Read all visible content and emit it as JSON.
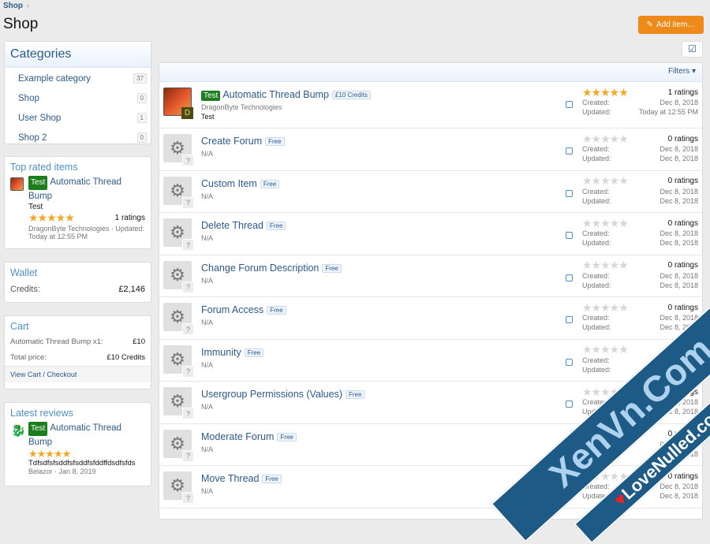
{
  "breadcrumb": "Shop",
  "title": "Shop",
  "add_item": "Add item…",
  "filters": "Filters",
  "categories": {
    "title": "Categories",
    "items": [
      {
        "label": "Example category",
        "count": "37"
      },
      {
        "label": "Shop",
        "count": "0"
      },
      {
        "label": "User Shop",
        "count": "1"
      },
      {
        "label": "Shop 2",
        "count": "0"
      }
    ]
  },
  "top_rated": {
    "title": "Top rated items",
    "tag": "Test",
    "name": "Automatic Thread Bump",
    "desc": "Test",
    "ratings": "1 ratings",
    "meta": "DragonByte Technologies · Updated: Today at 12:55 PM"
  },
  "wallet": {
    "title": "Wallet",
    "label": "Credits:",
    "value": "£2,146"
  },
  "cart": {
    "title": "Cart",
    "item": "Automatic Thread Bump x1:",
    "item_price": "£10",
    "total_label": "Total price:",
    "total": "£10 Credits",
    "checkout": "View Cart / Checkout"
  },
  "reviews": {
    "title": "Latest reviews",
    "tag": "Test",
    "name": "Automatic Thread Bump",
    "text": "Tdfsdfsfsddfsfsddfsfddffdsdfsfds",
    "meta": "Belazor · Jan 8, 2019"
  },
  "labels": {
    "created": "Created:",
    "updated": "Updated:"
  },
  "items": [
    {
      "tag": "Test",
      "name": "Automatic Thread Bump",
      "price": "£10 Credits",
      "author": "DragonByte Technologies",
      "desc": "Test",
      "rating": 5,
      "ratings": "1 ratings",
      "created": "Dec 8, 2018",
      "updated": "Today at 12:55 PM"
    },
    {
      "name": "Create Forum",
      "price": "Free",
      "author": "N/A",
      "rating": 0,
      "ratings": "0 ratings",
      "created": "Dec 8, 2018",
      "updated": "Dec 8, 2018"
    },
    {
      "name": "Custom Item",
      "price": "Free",
      "author": "N/A",
      "rating": 0,
      "ratings": "0 ratings",
      "created": "Dec 8, 2018",
      "updated": "Dec 8, 2018"
    },
    {
      "name": "Delete Thread",
      "price": "Free",
      "author": "N/A",
      "rating": 0,
      "ratings": "0 ratings",
      "created": "Dec 8, 2018",
      "updated": "Dec 8, 2018"
    },
    {
      "name": "Change Forum Description",
      "price": "Free",
      "author": "N/A",
      "rating": 0,
      "ratings": "0 ratings",
      "created": "Dec 8, 2018",
      "updated": "Dec 8, 2018"
    },
    {
      "name": "Forum Access",
      "price": "Free",
      "author": "N/A",
      "rating": 0,
      "ratings": "0 ratings",
      "created": "Dec 8, 2018",
      "updated": "Dec 8, 2018"
    },
    {
      "name": "Immunity",
      "price": "Free",
      "author": "N/A",
      "rating": 0,
      "ratings": "0 ratings",
      "created": "Dec 8, 2018",
      "updated": "Dec 8, 2018"
    },
    {
      "name": "Usergroup Permissions (Values)",
      "price": "Free",
      "author": "N/A",
      "rating": 0,
      "ratings": "0 ratings",
      "created": "Dec 8, 2018",
      "updated": "Dec 8, 2018"
    },
    {
      "name": "Moderate Forum",
      "price": "Free",
      "author": "N/A",
      "rating": 0,
      "ratings": "0 ratings",
      "created": "Dec 8, 2018",
      "updated": "Dec 8, 2018"
    },
    {
      "name": "Move Thread",
      "price": "Free",
      "author": "N/A",
      "rating": 0,
      "ratings": "0 ratings",
      "created": "Dec 8, 2018",
      "updated": "Dec 8, 2018"
    }
  ],
  "watermark": {
    "line1": "XenVn.Com",
    "line2": "LoveNulled.com"
  }
}
